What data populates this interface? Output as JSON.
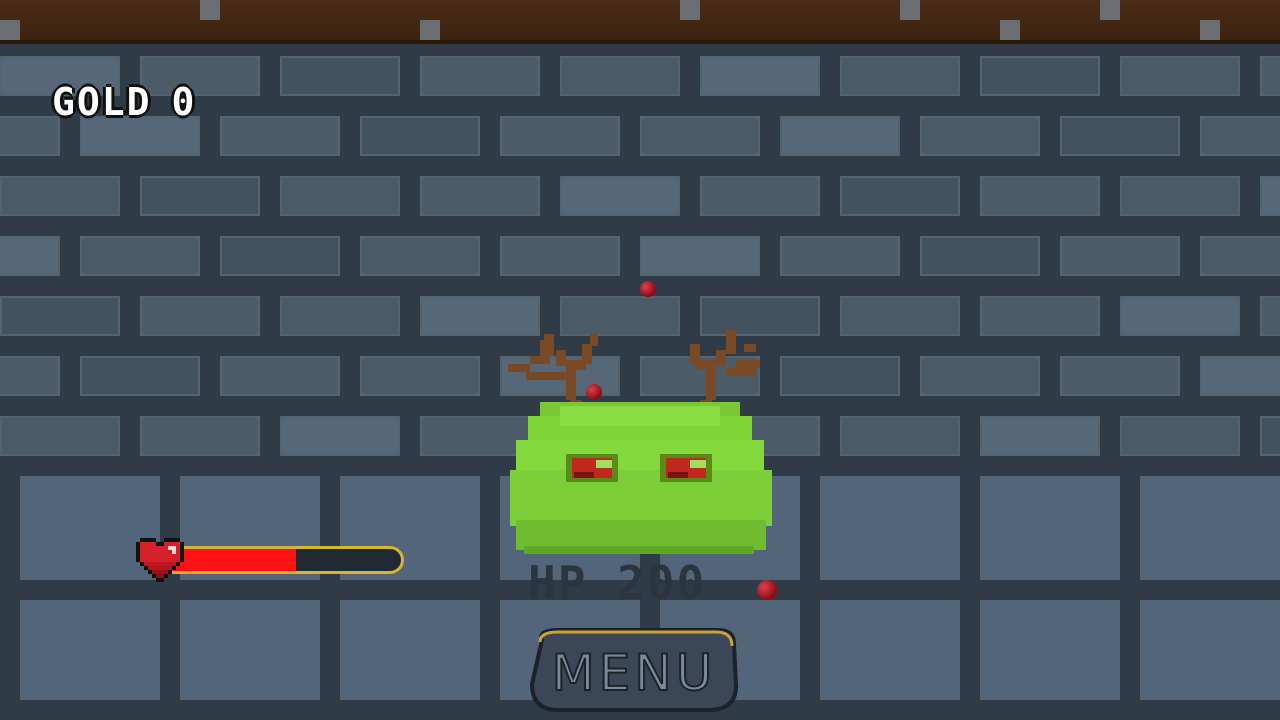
{
  "hud": {
    "gold_label": "GOLD",
    "gold_value": "0"
  },
  "player": {
    "health_fraction": 0.55
  },
  "enemy": {
    "name_icon": "antlered-green-slime",
    "hp_label": "HP 200"
  },
  "menu": {
    "label": "MENU"
  },
  "colors": {
    "health_fill": "#ff1212",
    "health_border": "#d6b430",
    "slime": "#7fd43a",
    "ceiling": "#4a2c16",
    "wall": "#4b5b68"
  }
}
